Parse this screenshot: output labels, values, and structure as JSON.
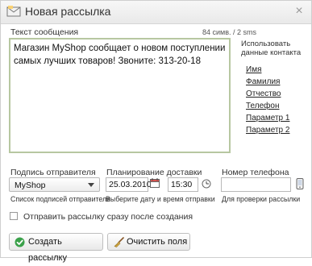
{
  "window": {
    "title": "Новая рассылка"
  },
  "message": {
    "label": "Текст сообщения",
    "counter": "84 симв. / 2 sms",
    "text": "Магазин MyShop сообщает о новом поступлении самых лучших товаров! Звоните: 313-20-18"
  },
  "contact_data": {
    "label": "Использовать данные контакта",
    "items": [
      "Имя",
      "Фамилия",
      "Отчество",
      "Телефон",
      "Параметр 1",
      "Параметр 2"
    ]
  },
  "sender": {
    "label": "Подпись отправителя",
    "value": "MyShop",
    "hint": "Список подписей отправителя"
  },
  "schedule": {
    "label": "Планирование доставки",
    "date": "25.03.2010",
    "time": "15:30",
    "hint": "Выберите дату и время отправки"
  },
  "phone": {
    "label": "Номер телефона",
    "value": "",
    "hint": "Для проверки рассылки"
  },
  "send_now": {
    "label": "Отправить рассылку сразу после создания",
    "checked": false
  },
  "buttons": {
    "create": "Создать рассылку",
    "clear": "Очистить поля"
  },
  "colors": {
    "textarea_border": "#b7c7a1",
    "create_icon": "#3aa14a"
  }
}
